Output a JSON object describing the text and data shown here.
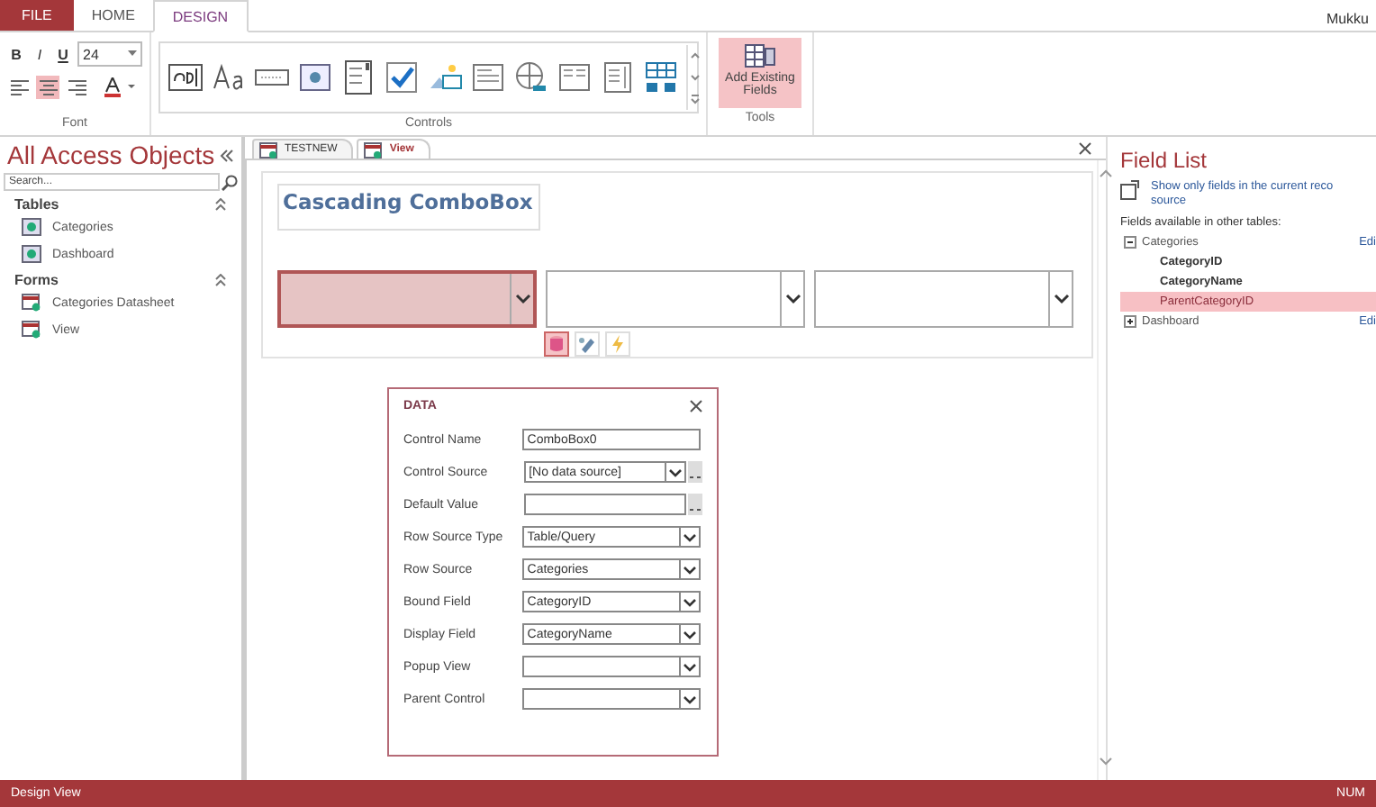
{
  "ribbon": {
    "tabs": [
      {
        "label": "FILE",
        "kind": "file",
        "selected": false
      },
      {
        "label": "HOME",
        "kind": "tab",
        "selected": false
      },
      {
        "label": "DESIGN",
        "kind": "tab",
        "selected": true
      }
    ],
    "user": "Mukku",
    "font_group": {
      "label": "Font",
      "size": "24",
      "align": [
        {
          "kind": "left",
          "selected": false
        },
        {
          "kind": "center",
          "selected": true
        },
        {
          "kind": "right",
          "selected": false
        }
      ],
      "styles": [
        "B",
        "I",
        "U"
      ]
    },
    "controls_group": {
      "label": "Controls",
      "items": [
        {
          "kind": "textbox"
        },
        {
          "kind": "label"
        },
        {
          "kind": "button"
        },
        {
          "kind": "tab"
        },
        {
          "kind": "list"
        },
        {
          "kind": "checkbox"
        },
        {
          "kind": "image"
        },
        {
          "kind": "form"
        },
        {
          "kind": "hyperlink"
        },
        {
          "kind": "navigation"
        },
        {
          "kind": "listbox"
        },
        {
          "kind": "grid"
        }
      ]
    },
    "tools_group": {
      "label": "Tools",
      "button": "Add Existing Fields",
      "selected": true
    }
  },
  "nav_pane": {
    "title": "All Access Objects",
    "search_placeholder": "Search...",
    "sections": [
      {
        "title": "Tables",
        "items": [
          {
            "label": "Categories",
            "kind": "table"
          },
          {
            "label": "Dashboard",
            "kind": "table"
          }
        ]
      },
      {
        "title": "Forms",
        "items": [
          {
            "label": "Categories Datasheet",
            "kind": "form"
          },
          {
            "label": "View",
            "kind": "form"
          }
        ]
      }
    ]
  },
  "documents": {
    "tabs": [
      {
        "label": "TESTNEW",
        "selected": false
      },
      {
        "label": "View",
        "selected": true
      }
    ],
    "form_title": "Cascading ComboBox",
    "combos": [
      {
        "selected": true
      },
      {
        "selected": false
      },
      {
        "selected": false
      }
    ],
    "tool_icons": [
      {
        "kind": "data",
        "selected": true
      },
      {
        "kind": "format",
        "selected": false
      },
      {
        "kind": "event",
        "selected": false
      }
    ],
    "property_sheet": {
      "title": "DATA",
      "rows": [
        {
          "label": "Control Name",
          "value": "ComboBox0",
          "kind": "text"
        },
        {
          "label": "Control Source",
          "value": "[No data source]",
          "kind": "dropdown-builder"
        },
        {
          "label": "Default Value",
          "value": "",
          "kind": "builder"
        },
        {
          "label": "Row Source Type",
          "value": "Table/Query",
          "kind": "dropdown"
        },
        {
          "label": "Row Source",
          "value": "Categories",
          "kind": "dropdown"
        },
        {
          "label": "Bound Field",
          "value": "CategoryID",
          "kind": "dropdown"
        },
        {
          "label": "Display Field",
          "value": "CategoryName",
          "kind": "dropdown"
        },
        {
          "label": "Popup View",
          "value": "",
          "kind": "dropdown"
        },
        {
          "label": "Parent Control",
          "value": "",
          "kind": "dropdown"
        }
      ]
    }
  },
  "field_list": {
    "title": "Field List",
    "show_only": [
      "Show only fields in the current reco",
      "source"
    ],
    "subtitle": "Fields available in other tables:",
    "tables": [
      {
        "name": "Categories",
        "edit": "Edi",
        "expanded": true,
        "children": [
          {
            "label": "CategoryID",
            "selected": false
          },
          {
            "label": "CategoryName",
            "selected": false
          },
          {
            "label": "ParentCategoryID",
            "selected": true
          }
        ]
      },
      {
        "name": "Dashboard",
        "edit": "Edi",
        "expanded": false
      }
    ]
  },
  "status_bar": {
    "left": "Design View",
    "right": "NUM"
  }
}
